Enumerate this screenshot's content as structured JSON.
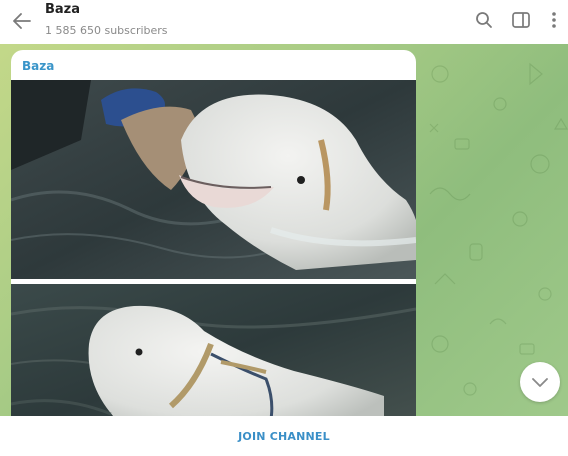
{
  "header": {
    "title": "Baza",
    "subscribers": "1 585 650 subscribers",
    "icons": [
      "back-arrow-icon",
      "search-icon",
      "sidebar-toggle-icon",
      "more-vertical-icon"
    ]
  },
  "message": {
    "sender": "Baza",
    "sender_color": "#3a95c9",
    "media": [
      {
        "description_icon": "photo-beluga-eating"
      },
      {
        "description_icon": "photo-beluga-harness"
      }
    ]
  },
  "footer": {
    "join_label": "JOIN CHANNEL",
    "join_color": "#3a8fc7"
  },
  "colors": {
    "wallpaper_start": "#c3d889",
    "wallpaper_end": "#8fbd7d"
  }
}
